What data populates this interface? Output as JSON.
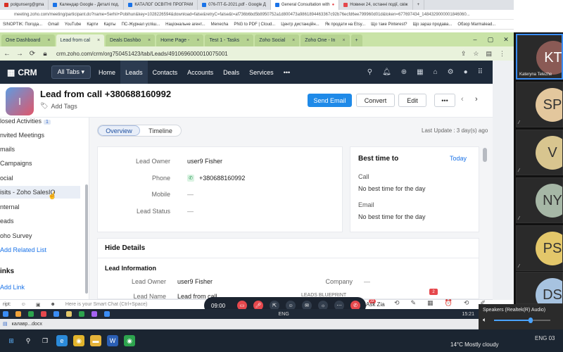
{
  "outer_tabs": [
    {
      "label": "polgunserg@gma",
      "color": "#d93025"
    },
    {
      "label": "Календар Google - Деталі под.",
      "color": "#1a73e8"
    },
    {
      "label": "КАТАЛОГ ОСВІТНІ ПРОГРАМ",
      "color": "#1a73e8"
    },
    {
      "label": "076-ПТ-Б-2021.pdf - Google Д",
      "color": "#1a73e8"
    },
    {
      "label": "General Consultation with",
      "color": "#1a73e8",
      "active": true
    },
    {
      "label": "Новини 24, останні події, свіж",
      "color": "#e5484d"
    }
  ],
  "outer_url": "meeting.zoho.com/meeting/participant.do?name=Serhii+Pobihun&key=1028226594&download=false&retryC=false&t=af736b6bd5b8950752a1d800473a9861894463367c92b76ecfd6ee799960d01d&token=677697434_1484329000001846060...",
  "bookmarks": [
    "SINOPTIK: Погода...",
    "Gmail",
    "YouTube",
    "Карти",
    "Карты",
    "ПС-Журнал успіш...",
    "Національне агент...",
    "Menecha",
    "PNG to PDF | Cloud...",
    "Центр дистанційн...",
    "Як продати на Etsy...",
    "Що таке Pinterest?",
    "Що зараз продава...",
    "Обзор Marmalead..."
  ],
  "inner_tabs": [
    {
      "label": "One Dashboard",
      "active": false
    },
    {
      "label": "Lead from cal",
      "active": true
    },
    {
      "label": "Deals Dashbo",
      "active": false
    },
    {
      "label": "Home Page -",
      "active": false
    },
    {
      "label": "Test 1 - Tasks",
      "active": false
    },
    {
      "label": "Zoho Social",
      "active": false
    },
    {
      "label": "Zoho One - In",
      "active": false
    }
  ],
  "inner_url": "crm.zoho.com/crm/org750451423/tab/Leads/4910696000010075001",
  "crm": {
    "logo": "CRM",
    "all_tabs": "All Tabs ▾",
    "nav": [
      "Home",
      "Leads",
      "Contacts",
      "Accounts",
      "Deals",
      "Services",
      "•••"
    ],
    "active_nav": "Leads"
  },
  "record": {
    "avatar_initial": "l",
    "title": "Lead from call +380688160992",
    "add_tags": "Add Tags",
    "send_email": "Send Email",
    "convert": "Convert",
    "edit": "Edit",
    "more": "•••"
  },
  "left_panel": {
    "closed_activities": "losed Activities",
    "closed_activities_count": "1",
    "invited_meetings": "nvited Meetings",
    "emails": "mails",
    "campaigns": "Campaigns",
    "social": "ocial",
    "visits": "isits - Zoho SalesIQ",
    "internal": "nternal",
    "leads": "eads",
    "survey": "oho Survey",
    "add_related": "Add Related List",
    "links_head": "inks",
    "add_link": "Add Link"
  },
  "content": {
    "overview": "Overview",
    "timeline": "Timeline",
    "last_update": "Last Update : 3 day(s) ago",
    "lead_owner_label": "Lead Owner",
    "lead_owner": "user9 Fisher",
    "phone_label": "Phone",
    "phone": "+380688160992",
    "mobile_label": "Mobile",
    "mobile": "—",
    "lead_status_label": "Lead Status",
    "lead_status": "—",
    "best_time_title": "Best time to",
    "best_time_today": "Today",
    "call_label": "Call",
    "call_value": "No best time for the day",
    "email_label": "Email",
    "email_value": "No best time for the day",
    "hide_details": "Hide Details",
    "lead_info": "Lead Information",
    "lead_owner_label2": "Lead Owner",
    "lead_owner2": "user9 Fisher",
    "company_label": "Company",
    "company": "—",
    "lead_name_label": "Lead Name",
    "lead_name": "Lead from call",
    "blueprint": "LEADS BLUEPRINT",
    "badge_count": "2"
  },
  "bottom": {
    "script": "ript:",
    "smartchat": "Here is your Smart Chat (Ctrl+Space)",
    "call_time": "09:00",
    "participants": "33",
    "ask_zia": "Ask Zia"
  },
  "inner_taskbar": {
    "lang": "ENG",
    "time": "15:21"
  },
  "file_tab": "калавр...docx",
  "sound": {
    "device": "Speakers (Realtek(R) Audio)",
    "level": 0.65
  },
  "taskbar": {
    "weather": "14°C  Mostly cloudy",
    "lang": "ENG",
    "time": "03"
  },
  "participants": [
    {
      "initials": "KT",
      "name": "Kateryna Telezhe",
      "color": "#8a5a55",
      "active": true
    },
    {
      "initials": "SP",
      "name": "",
      "color": "#e3c79d"
    },
    {
      "initials": "V",
      "name": "",
      "color": "#d8c58f"
    },
    {
      "initials": "NY",
      "name": "",
      "color": "#a6b7a6"
    },
    {
      "initials": "PS",
      "name": "",
      "color": "#e3c76a"
    },
    {
      "initials": "DS",
      "name": "",
      "color": "#a7c3e0"
    }
  ]
}
